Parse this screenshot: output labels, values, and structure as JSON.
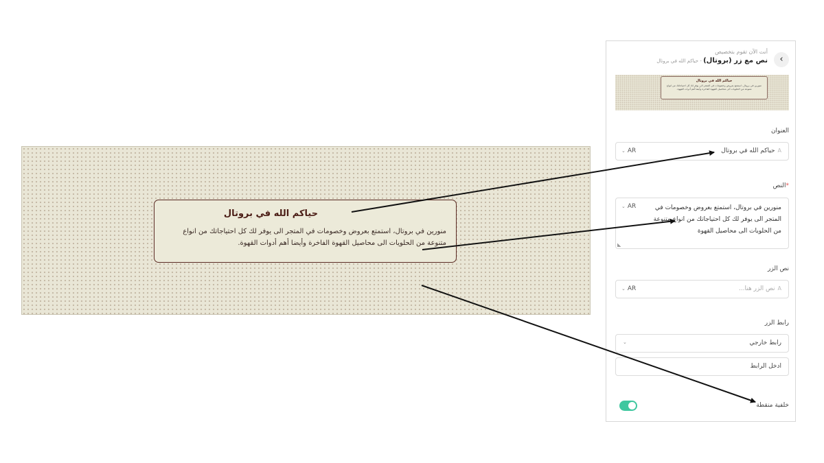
{
  "preview": {
    "title": "حياكم الله في بروتال",
    "body": "منورين في بروتال، استمتع بعروض وخصومات في المتجر الى يوفر لك كل احتياجاتك من انواع متنوعة من الحلويات الى محاصيل القهوة الفاخرة وأيضا أهم أدوات القهوة."
  },
  "panel": {
    "back_icon": "‹",
    "subtitle": "أنت الآن تقوم بتخصيص",
    "title": "نص مع زر (بروتال)",
    "title_suffix": " - حياكم الله في بروتال",
    "thumb": {
      "title": "حياكم الله في بروتال",
      "body": "منورين في بروتال، استمتع بعروض وخصومات في المتجر الى يوفر لك كل احتياجاتك من انواع متنوعة من الحلويات الى محاصيل القهوة الفاخرة وأيضا أهم أدوات القهوة."
    },
    "heading_label": "العنوان",
    "heading_value": "حياكم الله في بروتال",
    "text_label": "النص",
    "required_mark": "*",
    "text_value": "منورين في بروتال، استمتع بعروض وخصومات في المتجر الى يوفر لك كل احتياجاتك من انواع متنوعة من الحلويات الى محاصيل القهوة",
    "button_text_label": "نص الزر",
    "button_text_placeholder": "نص الزر هنا...",
    "button_link_label": "رابط الزر",
    "link_type_value": "رابط خارجي",
    "link_placeholder": "ادخل الرابط",
    "dotted_bg_label": "خلفية منقطة",
    "dotted_bg_enabled": true,
    "lang": "AR"
  },
  "colors": {
    "toggle_on": "#3fc79f",
    "card_border": "#5a2a23",
    "preview_bg": "#e9e6d6"
  }
}
